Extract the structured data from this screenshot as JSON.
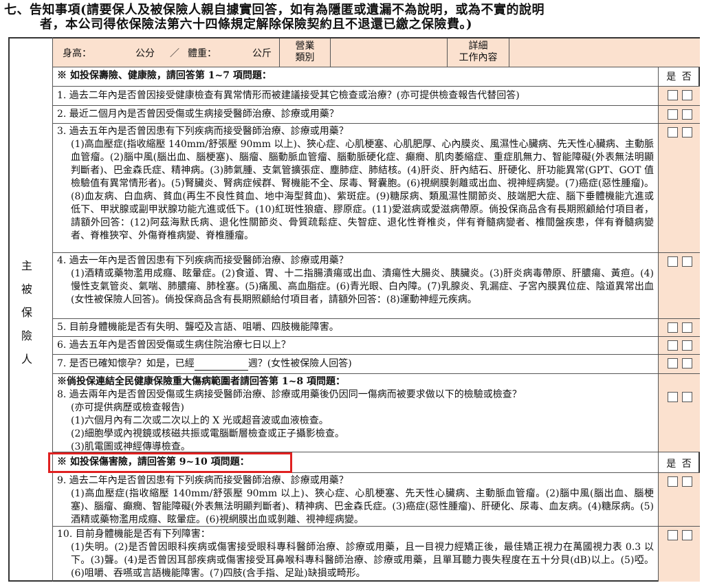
{
  "title": {
    "line1": "七、告知事項(請要保人及被保險人親自據實回答，如有為隱匿或遺漏不為說明，或為不實的說明",
    "line2": "者，本公司得依保險法第六十四條規定解除保險契約且不退還已繳之保險費。)"
  },
  "side_label": [
    "主",
    "被",
    "保",
    "險",
    "人"
  ],
  "top_row": {
    "height_label": "身高：",
    "cm": "公分",
    "slash": "／",
    "weight_label": "體重：",
    "kg": "公斤",
    "business_label_1": "營業",
    "business_label_2": "類別",
    "detail_label_1": "詳細",
    "detail_label_2": "工作內容"
  },
  "section1_header": "※ 如投保壽險、健康險，請回答第 1~7 項問題：",
  "yes_no": "是 否",
  "q1": "1. 過去二年內是否曾因接受健康檢查有異常情形而被建議接受其它檢查或治療？(亦可提供檢查報告代替回答)",
  "q2": "2. 最近二個月內是否曾因受傷或生病接受醫師治療、診療或用藥？",
  "q3_head": "3. 過去五年內是否曾因患有下列疾病而接受醫師治療、診療或用藥？",
  "q3_body": "(1)高血壓症(指收縮壓 140mm/舒張壓 90mm 以上)、狹心症、心肌梗塞、心肌肥厚、心內膜炎、風濕性心臟病、先天性心臟病、主動脈血管瘤。(2)腦中風(腦出血、腦梗塞)、腦瘤、腦動脈血管瘤、腦動脈硬化症、癲癇、肌肉萎縮症、重症肌無力、智能障礙(外表無法明顯判斷者)、巴金森氏症、精神病。(3)肺氣腫、支氣管擴張症、塵肺症、肺結核。(4)肝炎、肝內結石、肝硬化、肝功能異常(GPT、GOT 值檢驗值有異常情形者)。(5)腎臟炎、腎病症候群、腎機能不全、尿毒、腎囊胞。(6)視網膜剝離或出血、視神經病變。(7)癌症(惡性腫瘤)。(8)血友病、白血病、貧血(再生不良性貧血、地中海型貧血)、紫斑症。(9)糖尿病、類風濕性關節炎、肢端肥大症、腦下垂體機能亢進或低下、甲狀腺或副甲狀腺功能亢進或低下。(10)紅斑性狼瘡、膠原症。(11)愛滋病或愛滋病帶原。倘投保商品含有長期照顧給付項目者，請額外回答：(12)阿茲海默氏病、退化性關節炎、骨質疏鬆症、失智症、退化性脊椎炎，伴有脊髓病變者、椎間盤疾患，伴有脊髓病變者、脊椎狹窄、外傷脊椎病變、脊椎腫瘤。",
  "q4_head": "4. 過去一年內是否曾因患有下列疾病而接受醫師治療、診療或用藥？",
  "q4_body": "(1)酒精或藥物濫用成癮、眩暈症。(2)食道、胃、十二指腸潰瘍或出血、潰瘍性大腸炎、胰臟炎。(3)肝炎病毒帶原、肝膿瘍、黃疸。(4)慢性支氣管炎、氣喘、肺膿瘍、肺栓塞。(5)痛風、高血脂症。(6)青光眼、白內障。(7)乳腺炎、乳漏症、子宮內膜異位症、陰道異常出血(女性被保險人回答)。倘投保商品含有長期照顧給付項目者，請額外回答：(8)運動神經元疾病。",
  "q5": "5. 目前身體機能是否有失明、聾啞及言語、咀嚼、四肢機能障害。",
  "q6": "6. 過去五年內是否曾因受傷或生病住院治療七日以上？",
  "q7_pre": "7. 是否已確知懷孕？如是，已經",
  "q7_post": "週？(女性被保險人回答)",
  "q8_header": "※倘投保連結全民健康保險重大傷病範圍者請回答第 1~8 項問題：",
  "q8_head": "8. 過去兩年內是否曾因受傷或生病接受醫師治療、診療或用藥後仍因同一傷病而被要求做以下的檢驗或檢查？",
  "q8_l1": "(亦可提供病歷或檢查報告)",
  "q8_l2": "(1)六個月內有二次或二次以上的 X 光或超音波或血液檢查。",
  "q8_l3": "(2)細胞學或內視鏡或核磁共振或電腦斷層檢查或正子攝影檢查。",
  "q8_l4": "(3)肌電圖或神經傳導檢查。",
  "section2_header": "※ 如投保傷害險，請回答第 9~10 項問題：",
  "q9_head": "9. 過去二年內是否曾因患有下列疾病而接受醫師治療、診療或用藥？",
  "q9_body": "(1)高血壓症(指收縮壓 140mm/舒張壓 90mm 以上)、狹心症、心肌梗塞、先天性心臟病、主動脈血管瘤。(2)腦中風(腦出血、腦梗塞)、腦瘤、癲癇、智能障礙(外表無法明顯判斷者)、精神病、巴金森氏症。(3)癌症(惡性腫瘤)、肝硬化、尿毒、血友病。(4)糖尿病。(5)酒精或藥物濫用成癮、眩暈症。(6)視網膜出血或剝離、視神經病變。",
  "q10_head": "10. 目前身體機能是否有下列障害：",
  "q10_body": "(1)失明。(2)是否曾因眼科疾病或傷害接受眼科專科醫師治療、診療或用藥，且一目視力經矯正後，最佳矯正視力在萬國視力表 0.3 以下。(3)聾。(4)是否曾因耳部疾病或傷害接受耳鼻喉科專科醫師治療、診療或用藥，且單耳聽力喪失程度在五十分貝(dB)以上。(5)啞。(6)咀嚼、吞嚥或言語機能障害。(7)四肢(含手指、足趾)缺損或畸形。"
}
